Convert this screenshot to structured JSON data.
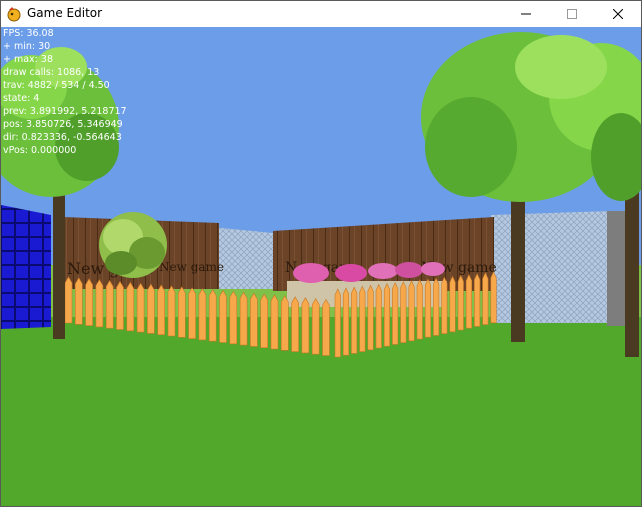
{
  "window": {
    "title": "Game Editor",
    "controls": {
      "minimize": "minimize",
      "maximize": "maximize",
      "close": "close"
    }
  },
  "hud": {
    "lines": [
      "FPS: 36.08",
      "+ min: 30",
      "+ max: 38",
      "draw calls: 1086, 13",
      "trav: 4882 / 534 / 4.50",
      "state: 4",
      "prev: 3.891992, 5.218717",
      "pos: 3.850726, 5.346949",
      "dir: 0.823336, -0.564643",
      "vPos: 0.000000"
    ]
  },
  "scene": {
    "sign_text": "New game",
    "colors": {
      "sky": "#6b9de8",
      "grass": "#52a82a",
      "wood_wall": "#6b4326",
      "picket": "#f7a84a",
      "leaves": "#6bbf3a",
      "trunk": "#4a3a22",
      "blue_block": "#1414c8"
    }
  }
}
